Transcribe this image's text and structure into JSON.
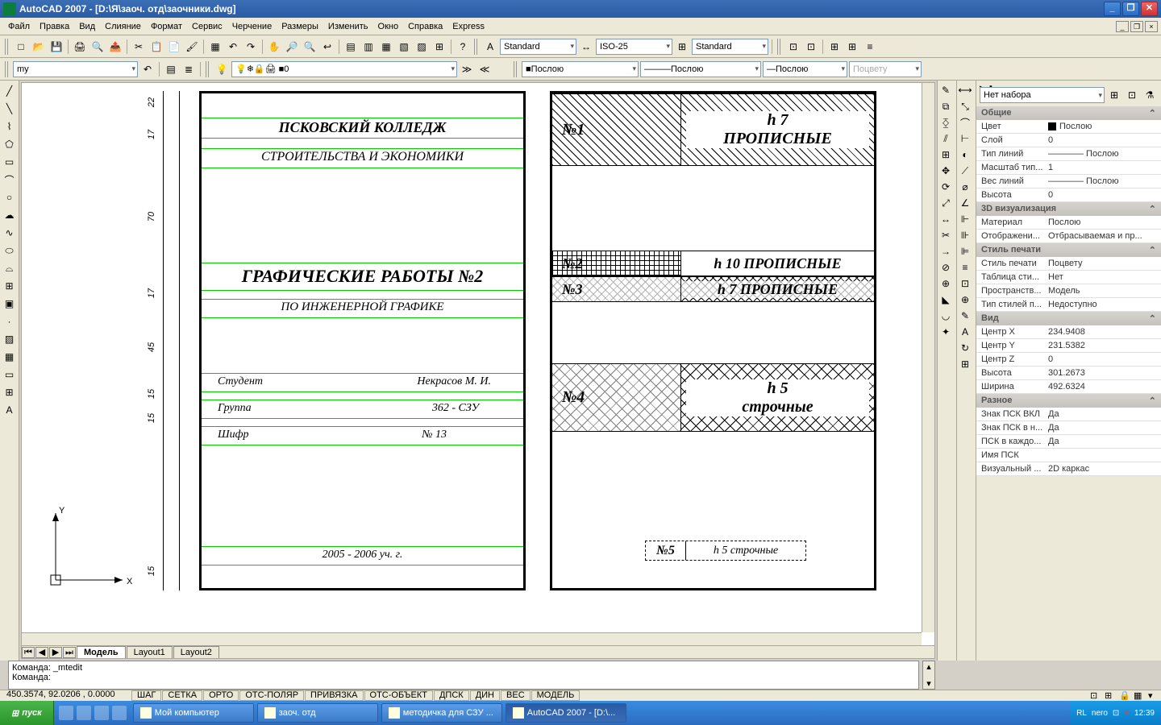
{
  "title": "AutoCAD 2007 - [D:\\Я\\заоч. отд\\заочники.dwg]",
  "menu": [
    "Файл",
    "Правка",
    "Вид",
    "Слияние",
    "Формат",
    "Сервис",
    "Черчение",
    "Размеры",
    "Изменить",
    "Окно",
    "Справка",
    "Express"
  ],
  "style_dropdowns": {
    "text_style": "Standard",
    "dim_style": "ISO-25",
    "table_style": "Standard"
  },
  "layer_row": {
    "layer_dd": "my",
    "layer_flags": "0",
    "layer_combo": "0"
  },
  "props_row": {
    "color": "Послою",
    "ltype": "Послою",
    "lweight": "Послою",
    "plot": "Поцвету"
  },
  "properties": {
    "no_set": "Нет набора",
    "sections": [
      {
        "title": "Общие",
        "rows": [
          {
            "k": "Цвет",
            "v": "Послою",
            "swatch": true
          },
          {
            "k": "Слой",
            "v": "0"
          },
          {
            "k": "Тип линий",
            "v": "———— Послою"
          },
          {
            "k": "Масштаб тип...",
            "v": "1"
          },
          {
            "k": "Вес линий",
            "v": "———— Послою"
          },
          {
            "k": "Высота",
            "v": "0"
          }
        ]
      },
      {
        "title": "3D визуализация",
        "rows": [
          {
            "k": "Материал",
            "v": "Послою"
          },
          {
            "k": "Отображени...",
            "v": "Отбрасываемая и пр..."
          }
        ]
      },
      {
        "title": "Стиль печати",
        "rows": [
          {
            "k": "Стиль печати",
            "v": "Поцвету"
          },
          {
            "k": "Таблица сти...",
            "v": "Нет"
          },
          {
            "k": "Пространств...",
            "v": "Модель"
          },
          {
            "k": "Тип стилей п...",
            "v": "Недоступно"
          }
        ]
      },
      {
        "title": "Вид",
        "rows": [
          {
            "k": "Центр X",
            "v": "234.9408"
          },
          {
            "k": "Центр Y",
            "v": "231.5382"
          },
          {
            "k": "Центр Z",
            "v": "0"
          },
          {
            "k": "Высота",
            "v": "301.2673"
          },
          {
            "k": "Ширина",
            "v": "492.6324"
          }
        ]
      },
      {
        "title": "Разное",
        "rows": [
          {
            "k": "Знак ПСК ВКЛ",
            "v": "Да"
          },
          {
            "k": "Знак ПСК в н...",
            "v": "Да"
          },
          {
            "k": "ПСК в каждо...",
            "v": "Да"
          },
          {
            "k": "Имя ПСК",
            "v": ""
          },
          {
            "k": "Визуальный ...",
            "v": "2D каркас"
          }
        ]
      }
    ]
  },
  "drawing": {
    "page1": {
      "lines": [
        "ПСКОВСКИЙ КОЛЛЕДЖ",
        "СТРОИТЕЛЬСТВА И ЭКОНОМИКИ",
        "ГРАФИЧЕСКИЕ РАБОТЫ №2",
        "ПО ИНЖЕНЕРНОЙ ГРАФИКЕ",
        "Студент",
        "Некрасов М. И.",
        "Группа",
        "362 - СЗУ",
        "Шифр",
        "№ 13",
        "2005 - 2006 уч. г."
      ],
      "dims": [
        "22",
        "17",
        "70",
        "17",
        "45",
        "15",
        "15",
        "15"
      ]
    },
    "page2": {
      "rows": [
        {
          "n": "№1",
          "t": "h 7\nПРОПИСНЫЕ"
        },
        {
          "n": "№2",
          "t": "h 10 ПРОПИСНЫЕ"
        },
        {
          "n": "№3",
          "t": "h 7 ПРОПИСНЫЕ"
        },
        {
          "n": "№4",
          "t": "h 5\nстрочные"
        },
        {
          "n": "№5",
          "t": "h 5 строчные"
        }
      ]
    }
  },
  "layout_tabs": [
    "Модель",
    "Layout1",
    "Layout2"
  ],
  "cmdline": [
    "Команда: _mtedit",
    "Команда:"
  ],
  "status": {
    "coords": "450.3574, 92.0206 , 0.0000",
    "toggles": [
      "ШАГ",
      "СЕТКА",
      "ОРТО",
      "ОТС-ПОЛЯР",
      "ПРИВЯЗКА",
      "ОТС-ОБЪЕКТ",
      "ДПСК",
      "ДИН",
      "ВЕС",
      "МОДЕЛЬ"
    ]
  },
  "taskbar": {
    "start": "пуск",
    "tasks": [
      {
        "label": "Мой компьютер",
        "active": false
      },
      {
        "label": "заоч. отд",
        "active": false
      },
      {
        "label": "методичка для СЗУ ...",
        "active": false
      },
      {
        "label": "AutoCAD 2007 - [D:\\...",
        "active": true
      }
    ],
    "tray_lang": "RL",
    "tray_time": "12:39"
  }
}
